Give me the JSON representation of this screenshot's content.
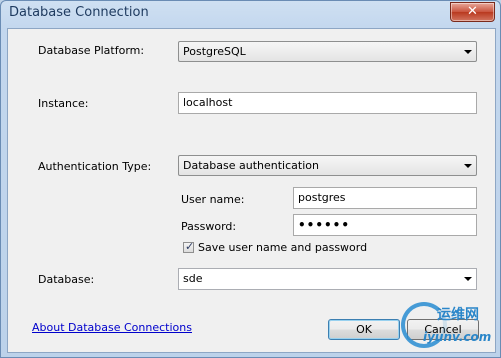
{
  "window": {
    "title": "Database Connection",
    "close_glyph": "✕"
  },
  "form": {
    "platform": {
      "label": "Database Platform:",
      "value": "PostgreSQL"
    },
    "instance": {
      "label": "Instance:",
      "value": "localhost"
    },
    "auth_type": {
      "label": "Authentication Type:",
      "value": "Database authentication"
    },
    "username": {
      "label": "User name:",
      "value": "postgres"
    },
    "password": {
      "label": "Password:",
      "value": "••••••"
    },
    "save_credentials": {
      "label": "Save user name and password",
      "checked": true
    },
    "database": {
      "label": "Database:",
      "value": "sde"
    }
  },
  "footer": {
    "about_link": "About Database Connections",
    "ok_label": "OK",
    "cancel_label": "Cancel"
  },
  "watermark": {
    "brand_cn": "运维网",
    "url": "iyunv.com"
  },
  "colors": {
    "link": "#0000cc",
    "title_bar": "#cfe0f2",
    "client_bg": "#f0f0f0"
  }
}
